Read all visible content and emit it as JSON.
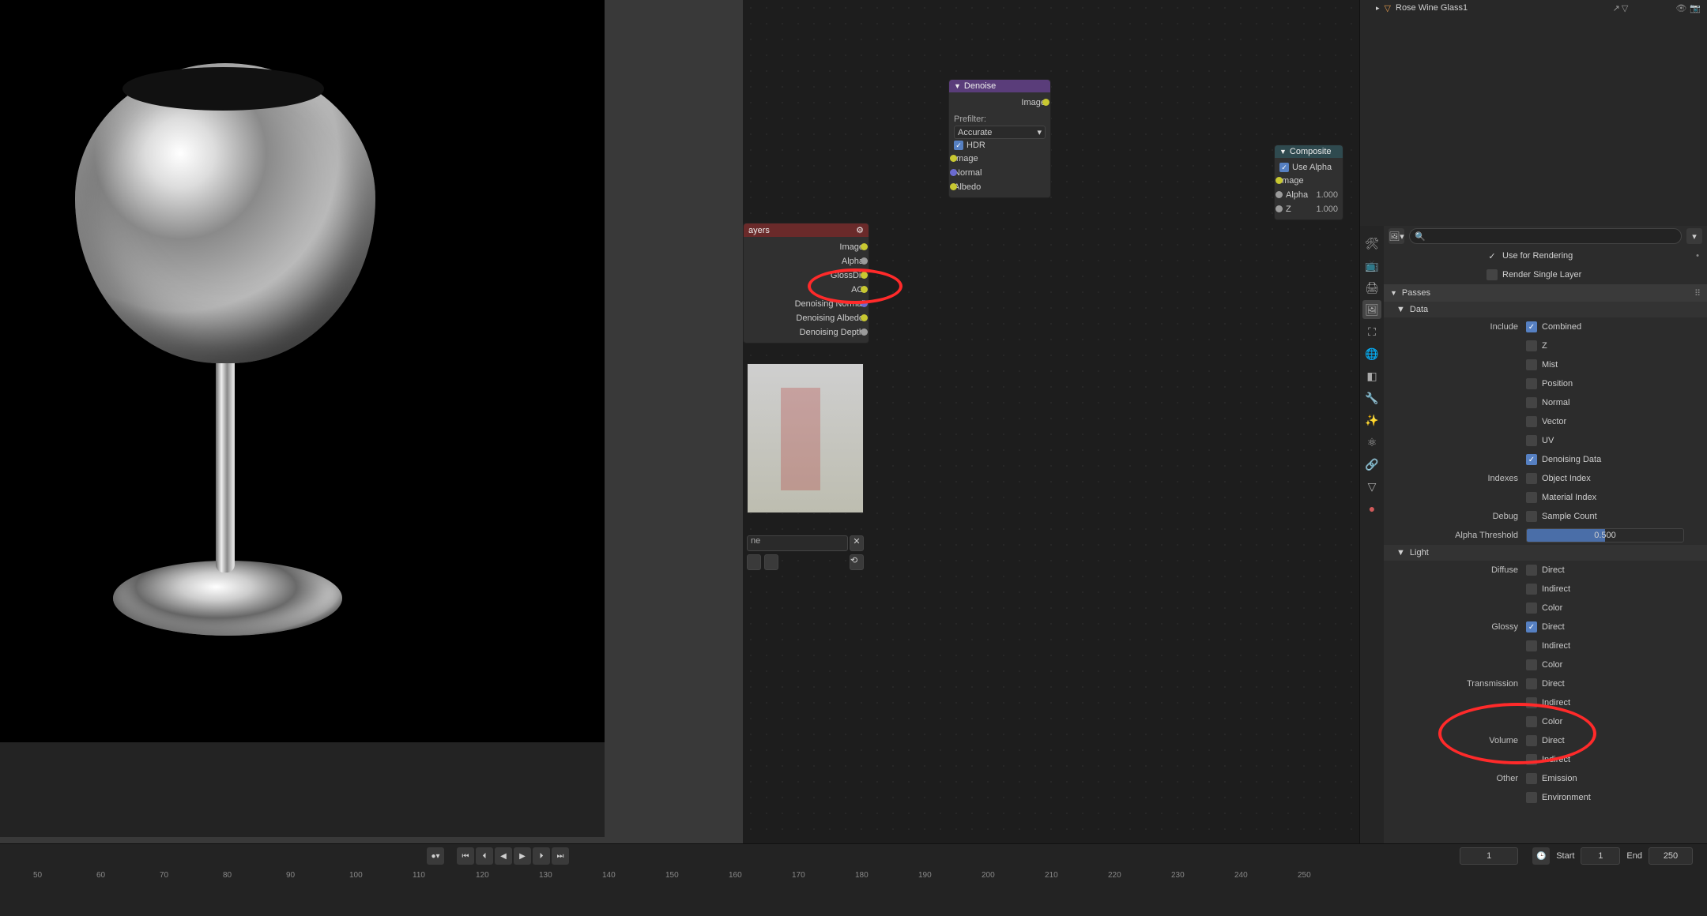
{
  "outliner": {
    "object_name": "Rose Wine Glass1"
  },
  "render_layers_node": {
    "title": "ayers",
    "outputs": [
      "Image",
      "Alpha",
      "GlossDir",
      "AO",
      "Denoising Normal",
      "Denoising Albedo",
      "Denoising Depth"
    ]
  },
  "denoise_node": {
    "title": "Denoise",
    "out_image": "Image",
    "prefilter_label": "Prefilter:",
    "prefilter_value": "Accurate",
    "hdr_row": "HDR",
    "inputs": [
      "Image",
      "Normal",
      "Albedo"
    ]
  },
  "composite_node": {
    "title": "Composite",
    "use_alpha": "Use Alpha",
    "inputs": [
      "Image",
      "Alpha",
      "Z"
    ],
    "alpha_val": "1.000",
    "z_val": "1.000"
  },
  "timeline": {
    "frame_current": "1",
    "start_label": "Start",
    "start_val": "1",
    "end_label": "End",
    "end_val": "250",
    "ticks": [
      "50",
      "60",
      "70",
      "80",
      "90",
      "100",
      "110",
      "120",
      "130",
      "140",
      "150",
      "160",
      "170",
      "180",
      "190",
      "200",
      "210",
      "220",
      "230",
      "240",
      "250"
    ]
  },
  "props": {
    "use_for_rendering": "Use for Rendering",
    "render_single": "Render Single Layer",
    "passes_header": "Passes",
    "data_header": "Data",
    "light_header": "Light",
    "include_label": "Include",
    "include_items": [
      {
        "name": "Combined",
        "on": true
      },
      {
        "name": "Z",
        "on": false
      },
      {
        "name": "Mist",
        "on": false
      },
      {
        "name": "Position",
        "on": false
      },
      {
        "name": "Normal",
        "on": false
      },
      {
        "name": "Vector",
        "on": false
      },
      {
        "name": "UV",
        "on": false
      },
      {
        "name": "Denoising Data",
        "on": true
      }
    ],
    "indexes_label": "Indexes",
    "indexes_items": [
      {
        "name": "Object Index",
        "on": false
      },
      {
        "name": "Material Index",
        "on": false
      }
    ],
    "debug_label": "Debug",
    "debug_items": [
      {
        "name": "Sample Count",
        "on": false
      }
    ],
    "alpha_thresh_label": "Alpha Threshold",
    "alpha_thresh_val": "0.500",
    "diffuse_label": "Diffuse",
    "diffuse_items": [
      {
        "name": "Direct",
        "on": false
      },
      {
        "name": "Indirect",
        "on": false
      },
      {
        "name": "Color",
        "on": false
      }
    ],
    "glossy_label": "Glossy",
    "glossy_items": [
      {
        "name": "Direct",
        "on": true
      },
      {
        "name": "Indirect",
        "on": false
      },
      {
        "name": "Color",
        "on": false
      }
    ],
    "transmission_label": "Transmission",
    "transmission_items": [
      {
        "name": "Direct",
        "on": false
      },
      {
        "name": "Indirect",
        "on": false
      },
      {
        "name": "Color",
        "on": false
      }
    ],
    "volume_label": "Volume",
    "volume_items": [
      {
        "name": "Direct",
        "on": false
      },
      {
        "name": "Indirect",
        "on": false
      }
    ],
    "other_label": "Other",
    "other_items": [
      {
        "name": "Emission",
        "on": false
      },
      {
        "name": "Environment",
        "on": false
      }
    ]
  }
}
